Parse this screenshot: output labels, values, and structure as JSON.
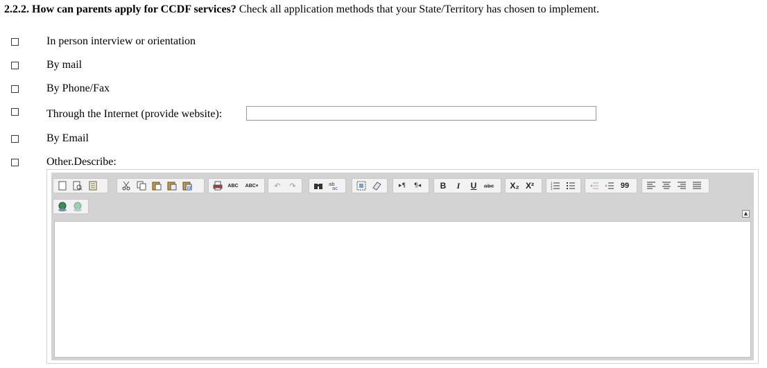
{
  "question": {
    "number": "2.2.2.",
    "bold_text": "How can parents apply for CCDF services?",
    "instruction": "Check all application methods that your State/Territory has chosen to implement."
  },
  "options": [
    {
      "label": "In person interview or orientation",
      "checked": false
    },
    {
      "label": "By mail",
      "checked": false
    },
    {
      "label": "By Phone/Fax",
      "checked": false
    },
    {
      "label": "Through the Internet (provide website):",
      "checked": false
    },
    {
      "label": "By Email",
      "checked": false
    },
    {
      "label": "Other.Describe:",
      "checked": false
    }
  ],
  "website_input": {
    "value": "",
    "placeholder": ""
  },
  "editor": {
    "content": "",
    "toolbar": {
      "groups": [
        [
          "new-page-icon",
          "preview-icon",
          "templates-icon"
        ],
        [
          "cut-icon",
          "copy-icon",
          "paste-icon",
          "paste-text-icon",
          "paste-word-icon"
        ],
        [
          "print-icon",
          "spellcheck-icon",
          "spellcheck-as-you-type-icon"
        ],
        [
          "undo-icon",
          "redo-icon"
        ],
        [
          "find-icon",
          "replace-icon"
        ],
        [
          "select-all-icon",
          "remove-format-icon"
        ],
        [
          "ltr-icon",
          "rtl-icon"
        ],
        [
          "bold-icon",
          "italic-icon",
          "underline-icon",
          "strike-icon"
        ],
        [
          "subscript-icon",
          "superscript-icon"
        ],
        [
          "numbered-list-icon",
          "bulleted-list-icon"
        ],
        [
          "outdent-icon",
          "indent-icon",
          "blockquote-icon"
        ],
        [
          "align-left-icon",
          "align-center-icon",
          "align-right-icon",
          "justify-icon"
        ],
        [
          "link-icon",
          "unlink-icon"
        ]
      ],
      "labels": {
        "bold": "B",
        "italic": "I",
        "underline": "U",
        "strike": "abc",
        "subscript": "X₂",
        "superscript": "X²",
        "blockquote": "99",
        "spell": "ABC"
      }
    }
  }
}
